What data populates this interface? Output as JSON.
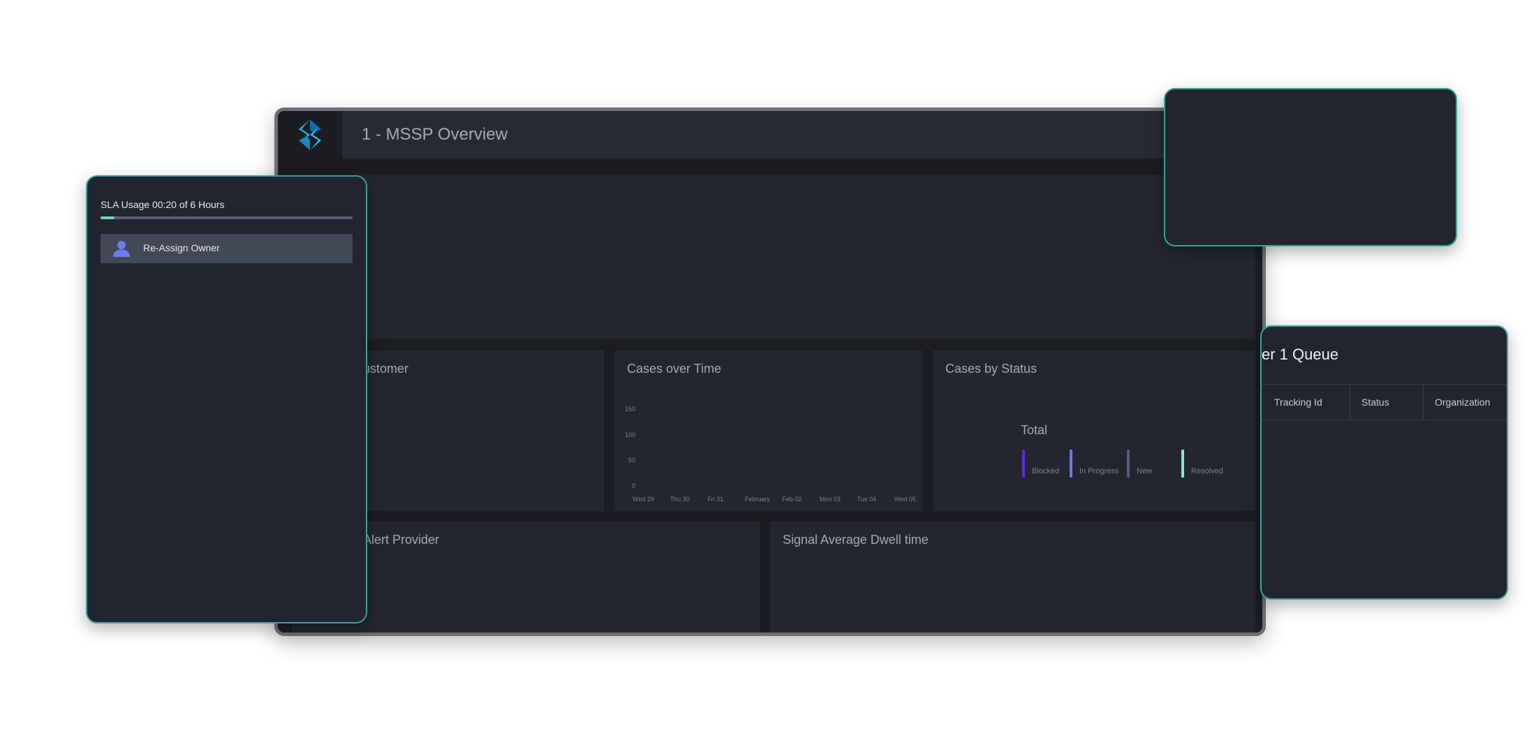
{
  "dashboard": {
    "title": "1 - MSSP Overview",
    "panels": {
      "by_customer": "ustomer",
      "cases_over_time": "Cases over Time",
      "cases_by_status": "Cases by Status",
      "alert_provider": "Alert Provider",
      "dwell_time": "Signal Average Dwell time"
    }
  },
  "chart_data": [
    {
      "type": "line",
      "title": "Cases over Time",
      "categories": [
        "Wed 29",
        "Thu 30",
        "Fri 31",
        "February",
        "Feb 02",
        "Mon 03",
        "Tue 04",
        "Wed 05"
      ],
      "yticks": [
        "150",
        "100",
        "50",
        "0"
      ],
      "ylim": [
        0,
        150
      ],
      "series": []
    },
    {
      "type": "bar",
      "title": "Cases by Status",
      "total_label": "Total",
      "legend": [
        {
          "label": "Blocked",
          "color": "#5b2fd1"
        },
        {
          "label": "In Progress",
          "color": "#7277e6"
        },
        {
          "label": "New",
          "color": "#565b80"
        },
        {
          "label": "Resolved",
          "color": "#8ee3cf"
        }
      ]
    }
  ],
  "sla": {
    "title": "SLA Usage 00:20 of 6 Hours",
    "progress_fraction": 0.0556,
    "reassign_label": "Re-Assign Owner",
    "icon": "person-icon"
  },
  "queue": {
    "title": "er 1 Queue",
    "columns": [
      "Tracking Id",
      "Status",
      "Organization"
    ]
  },
  "colors": {
    "accent": "#3aa596",
    "progress": "#72d2be",
    "logo_primary": "#1fb8e6",
    "logo_secondary": "#0f6ea8"
  }
}
